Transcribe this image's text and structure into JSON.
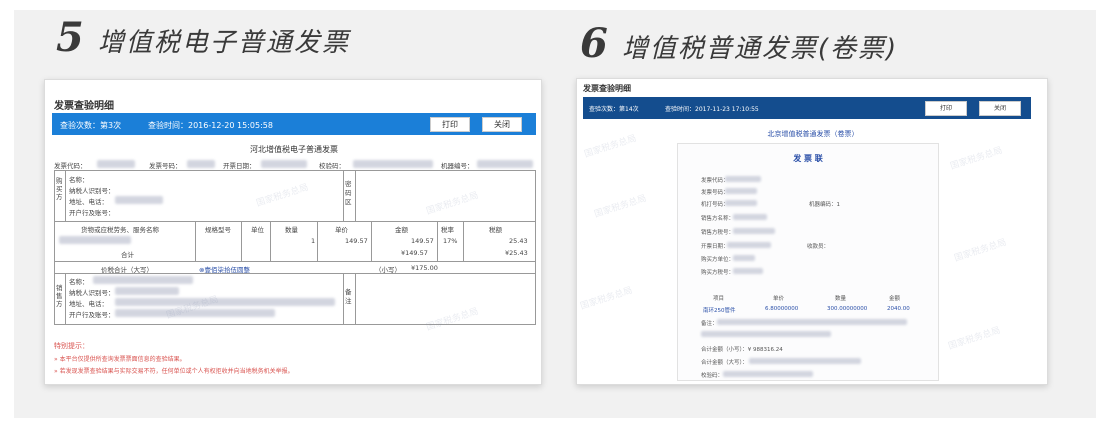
{
  "headings": [
    {
      "number": "5",
      "title": "增值税电子普通发票"
    },
    {
      "number": "6",
      "title": "增值税普通发票(卷票)"
    }
  ],
  "panel5": {
    "header": "发票查验明细",
    "check_count": "查验次数：第3次",
    "check_time": "查验时间：2016-12-20 15:05:58",
    "print_button": "打印",
    "close_button": "关闭",
    "invoice_title": "河北增值税电子普通发票",
    "meta_labels": [
      "发票代码：",
      "发票号码：",
      "开票日期：",
      "校验码：",
      "机器编号："
    ],
    "buyer_side_label": "购买方",
    "buyer_fields": [
      "名称：",
      "纳税人识别号：",
      "地址、电话：",
      "开户行及账号："
    ],
    "cipher_label": "密码区",
    "table_headers": [
      "货物或应税劳务、服务名称",
      "规格型号",
      "单位",
      "数量",
      "单价",
      "金额",
      "税率",
      "税额"
    ],
    "row": {
      "qty": "1",
      "price": "149.57",
      "amount": "149.57",
      "tax_rate": "17%",
      "tax": "25.43"
    },
    "subtotal_label": "合计",
    "subtotal_amount": "¥149.57",
    "subtotal_tax": "¥25.43",
    "total_label": "价税合计（大写）",
    "total_words": "⊗壹佰柒拾伍圆整",
    "total_small_label": "（小写）",
    "total_small": "¥175.00",
    "seller_side_label": "销售方",
    "seller_fields": [
      "名称：",
      "纳税人识别号：",
      "地址、电话：",
      "开户行及账号："
    ],
    "remark_label": "备注",
    "notice_title": "特别提示：",
    "notices": [
      "» 本平台仅提供所查询发票票面信息的查验结果。",
      "» 若发现发票查验结果与实际交易不符，任何单位或个人有权拒收并向当地税务机关举报。"
    ],
    "watermark": "国家税务总局"
  },
  "panel6": {
    "header": "发票查验明细",
    "check_count": "查验次数：第14次",
    "check_time": "查验时间：2017-11-23 17:10:55",
    "print_button": "打印",
    "close_button": "关闭",
    "invoice_title": "北京增值税普通发票（卷票）",
    "subtitle": "发 票 联",
    "fields": [
      "发票代码：",
      "发票号码：",
      "机打号码：",
      "销售方名称：",
      "销售方税号：",
      "开票日期：",
      "购买方单位：",
      "购买方税号："
    ],
    "machine_label": "机器编码：1",
    "cashier_label": "收款员：",
    "table_headers": [
      "项目",
      "单价",
      "数量",
      "金额"
    ],
    "row": {
      "item": "南环250管件",
      "price": "6.80000000",
      "qty": "300.00000000",
      "amount": "2040.00"
    },
    "remark_label": "备注：",
    "total_small": "合计金额（小写）：¥ 988316.24",
    "total_big": "合计金额（大写）：",
    "check_code": "校验码：",
    "watermark": "国家税务总局"
  }
}
